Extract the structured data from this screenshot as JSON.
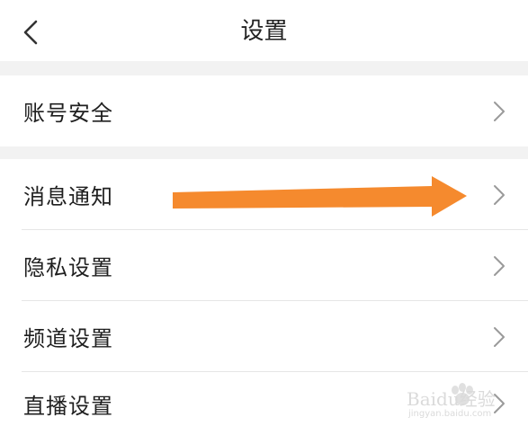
{
  "header": {
    "title": "设置",
    "back_icon": "chevron-left-icon"
  },
  "settings": {
    "items": [
      {
        "label": "账号安全",
        "icon": "chevron-right-icon"
      },
      {
        "label": "消息通知",
        "icon": "chevron-right-icon"
      },
      {
        "label": "隐私设置",
        "icon": "chevron-right-icon"
      },
      {
        "label": "频道设置",
        "icon": "chevron-right-icon"
      },
      {
        "label": "直播设置",
        "icon": "chevron-right-icon"
      }
    ]
  },
  "annotation": {
    "arrow_color": "#f58a2e",
    "points_to": "消息通知"
  },
  "watermark": {
    "brand": "Baidu经验",
    "url": "jingyan.baidu.com"
  },
  "colors": {
    "background": "#ffffff",
    "section_gap": "#f2f2f2",
    "text": "#1f1f1f",
    "chevron": "#9a9a9a"
  }
}
